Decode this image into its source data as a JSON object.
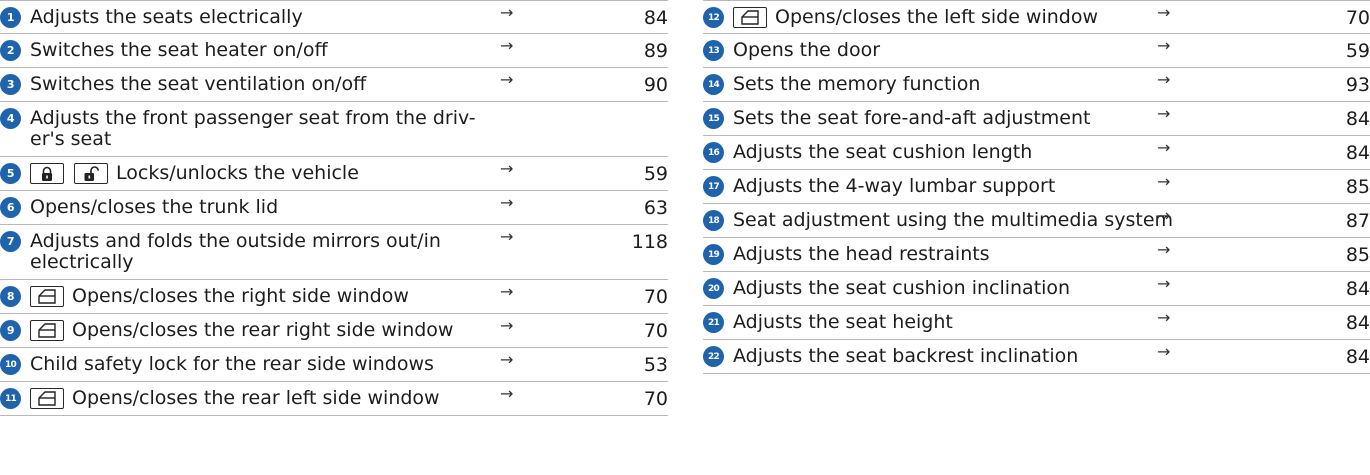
{
  "arrow_symbol": "→",
  "colors": {
    "badge": "#1f63ad",
    "rule": "#b9b9b9"
  },
  "left_rows": [
    {
      "num": "1",
      "text": "Adjusts the seats electrically",
      "page": "84",
      "icons": []
    },
    {
      "num": "2",
      "text": "Switches the seat heater on/off",
      "page": "89",
      "icons": []
    },
    {
      "num": "3",
      "text": "Switches the seat ventilation on/off",
      "page": "90",
      "icons": []
    },
    {
      "num": "4",
      "text": "Adjusts the front passenger seat from the driver's seat",
      "text_html_break": [
        "Adjusts the front passenger seat from the driv-",
        "er's seat"
      ],
      "page": "",
      "icons": []
    },
    {
      "num": "5",
      "text": "Locks/unlocks the vehicle",
      "page": "59",
      "icons": [
        "lock-icon",
        "unlock-icon"
      ]
    },
    {
      "num": "6",
      "text": "Opens/closes the trunk lid",
      "page": "63",
      "icons": []
    },
    {
      "num": "7",
      "text": "Adjusts and folds the outside mirrors out/in electrically",
      "text_html_break": [
        "Adjusts and folds the outside mirrors out/in",
        "electrically"
      ],
      "page": "118",
      "icons": []
    },
    {
      "num": "8",
      "text": "Opens/closes the right side window",
      "page": "70",
      "icons": [
        "window-icon"
      ]
    },
    {
      "num": "9",
      "text": "Opens/closes the rear right side window",
      "page": "70",
      "icons": [
        "window-icon"
      ]
    },
    {
      "num": "10",
      "text": "Child safety lock for the rear side windows",
      "page": "53",
      "icons": []
    },
    {
      "num": "11",
      "text": "Opens/closes the rear left side window",
      "page": "70",
      "icons": [
        "window-icon"
      ]
    }
  ],
  "right_rows": [
    {
      "num": "12",
      "text": "Opens/closes the left side window",
      "page": "70",
      "icons": [
        "window-icon"
      ]
    },
    {
      "num": "13",
      "text": "Opens the door",
      "page": "59",
      "icons": []
    },
    {
      "num": "14",
      "text": "Sets the memory function",
      "page": "93",
      "icons": []
    },
    {
      "num": "15",
      "text": "Sets the seat fore-and-aft adjustment",
      "page": "84",
      "icons": []
    },
    {
      "num": "16",
      "text": "Adjusts the seat cushion length",
      "page": "84",
      "icons": []
    },
    {
      "num": "17",
      "text": "Adjusts the 4-way lumbar support",
      "page": "85",
      "icons": []
    },
    {
      "num": "18",
      "text": "Seat adjustment using the multimedia system",
      "page": "87",
      "icons": []
    },
    {
      "num": "19",
      "text": "Adjusts the head restraints",
      "page": "85",
      "icons": []
    },
    {
      "num": "20",
      "text": "Adjusts the seat cushion inclination",
      "page": "84",
      "icons": []
    },
    {
      "num": "21",
      "text": "Adjusts the seat height",
      "page": "84",
      "icons": []
    },
    {
      "num": "22",
      "text": "Adjusts the seat backrest inclination",
      "page": "84",
      "icons": []
    }
  ]
}
